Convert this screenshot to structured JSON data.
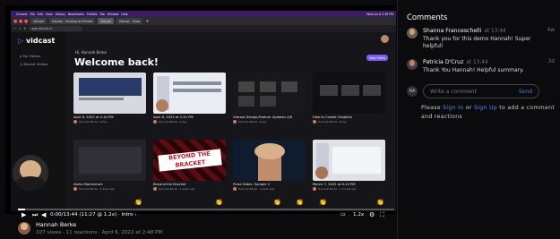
{
  "browser": {
    "menu": [
      "Chrome",
      "File",
      "Edit",
      "View",
      "History",
      "Bookmarks",
      "Profiles",
      "Tab",
      "Window",
      "Help"
    ],
    "menu_right": "Wed Jun 8 2:38 PM",
    "tabs": [
      "Vidcast",
      "Vidcast - Sending for Private",
      "Vidcast",
      "Vidcast - Show"
    ],
    "address": "app.vidcast.io"
  },
  "app": {
    "logo": "vidcast",
    "nav": [
      "My Videos",
      "Recent Videos"
    ],
    "greeting": "Hi, Hannah Berke",
    "welcome": "Welcome back!",
    "new_video": "New Video",
    "cards": [
      {
        "title": "April 6, 2022 at 2:44 PM",
        "author": "Hannah Berke",
        "meta": "today"
      },
      {
        "title": "April 6, 2022 at 2:41 PM",
        "author": "Hannah Berke",
        "meta": "today"
      },
      {
        "title": "Vidcast Design/Feature Updates 4/6",
        "author": "Hannah Berke",
        "meta": "today"
      },
      {
        "title": "How to Create Chapters",
        "author": "Hannah Berke",
        "meta": "today"
      },
      {
        "title": "Alpha Momentum",
        "author": "Hannah Berke",
        "meta": "4 days ago"
      },
      {
        "title": "Beyond the Bracket",
        "author": "Hannah Berke",
        "meta": "1 week ago"
      },
      {
        "title": "Prest Slides: Sample 2",
        "author": "Hannah Berke",
        "meta": "1 week ago"
      },
      {
        "title": "March 7, 2022 at 6:15 PM",
        "author": "Hannah Berke",
        "meta": "1 month ago"
      }
    ],
    "bracket_text": "BEYOND THE BRACKET"
  },
  "player": {
    "timecode": "0:00/13:44 (11:27 @ 1.2x)",
    "chapter": "Intro",
    "speed": "1.2x",
    "progress_fraction": 0.02
  },
  "video": {
    "author": "Hannah Berke",
    "views": "107 views",
    "reactions": "11 reactions",
    "date": "April 6, 2022 at 2:48 PM"
  },
  "comments": {
    "title": "Comments",
    "items": [
      {
        "name": "Shanna Franceschelli",
        "time": "at 13:44",
        "age": "4w",
        "text": "Thank you for this demo Hannah! Super helpful!"
      },
      {
        "name": "Patricia D'Cruz",
        "time": "at 13:44",
        "age": "3d",
        "text": "Thank You Hannah! Helpful summary."
      }
    ],
    "input_initials": "NA",
    "input_placeholder": "Write a comment",
    "send": "Send",
    "signin_prefix": "Please",
    "sign_in": "Sign In",
    "or": "or",
    "sign_up": "Sign Up",
    "signin_suffix": "to add a comment and reactions"
  },
  "colors": {
    "accent": "#7c5cf5",
    "link": "#4e8dff",
    "menubar": "#3a1d63"
  },
  "icons": [
    "play-icon",
    "skip-forward-icon",
    "volume-icon",
    "captions-icon",
    "settings-icon",
    "fullscreen-icon",
    "clap-icon"
  ]
}
